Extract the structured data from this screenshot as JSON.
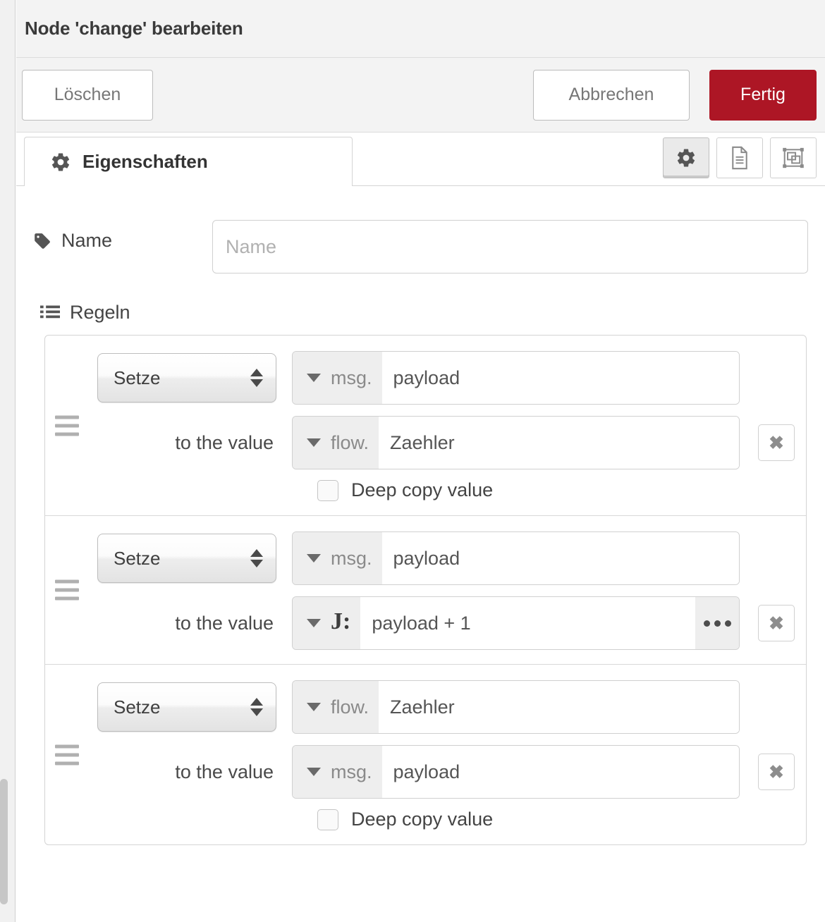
{
  "dialog": {
    "title": "Node 'change' bearbeiten",
    "buttons": {
      "delete": "Löschen",
      "cancel": "Abbrechen",
      "done": "Fertig"
    },
    "accent_color": "#ad1625"
  },
  "tabs": [
    {
      "label": "Eigenschaften",
      "icon": "gear-icon",
      "active": true
    }
  ],
  "tool_buttons": [
    {
      "icon": "gear-icon",
      "name": "properties-tool",
      "active": true
    },
    {
      "icon": "description-icon",
      "name": "description-tool",
      "active": false
    },
    {
      "icon": "appearance-icon",
      "name": "appearance-tool",
      "active": false
    }
  ],
  "form": {
    "name_field": {
      "icon": "tag-icon",
      "label": "Name",
      "value": "",
      "placeholder": "Name"
    },
    "rules_section": {
      "icon": "list-icon",
      "label": "Regeln"
    },
    "to_the_value_label": "to the value",
    "deep_copy_label": "Deep copy value",
    "delete_rule_label": "✖"
  },
  "rules": [
    {
      "operation": "Setze",
      "target": {
        "type": "msg.",
        "value": "payload"
      },
      "value": {
        "type": "flow.",
        "value": "Zaehler",
        "kind": "typed"
      },
      "deep_copy": {
        "shown": true,
        "checked": false
      }
    },
    {
      "operation": "Setze",
      "target": {
        "type": "msg.",
        "value": "payload"
      },
      "value": {
        "type": "J:",
        "value": "payload + 1",
        "kind": "jsonata",
        "expand": "•••"
      },
      "deep_copy": {
        "shown": false,
        "checked": false
      }
    },
    {
      "operation": "Setze",
      "target": {
        "type": "flow.",
        "value": "Zaehler"
      },
      "value": {
        "type": "msg.",
        "value": "payload",
        "kind": "typed"
      },
      "deep_copy": {
        "shown": true,
        "checked": false
      }
    }
  ]
}
